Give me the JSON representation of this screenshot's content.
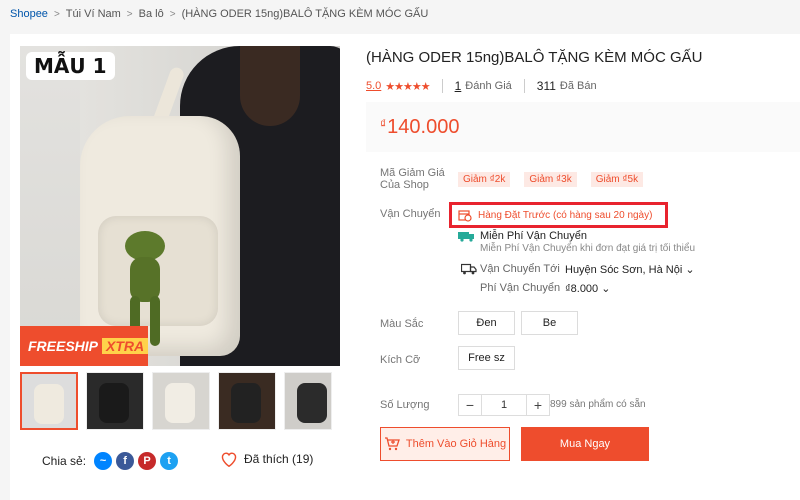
{
  "breadcrumb": {
    "items": [
      "Shopee",
      "Túi Ví Nam",
      "Ba lô",
      "(HÀNG ODER 15ng)BALÔ TẶNG KÈM MÓC GẤU"
    ]
  },
  "gallery": {
    "badge": "MẪU 1",
    "freeship": "FREESHIP",
    "xtra": "XTRA"
  },
  "share": {
    "label": "Chia sẻ:"
  },
  "like": {
    "label": "Đã thích (19)"
  },
  "product": {
    "title": "(HÀNG ODER 15ng)BALÔ TẶNG KÈM MÓC GẤU",
    "rating": "5.0",
    "stars": "★★★★★",
    "reviews_count": "1",
    "reviews_label": "Đánh Giá",
    "sold_count": "311",
    "sold_label": "Đã Bán",
    "currency": "₫",
    "price": "140.000"
  },
  "vouchers": {
    "label": "Mã Giảm Giá Của Shop",
    "items": [
      "Giảm ₫2k",
      "Giảm ₫3k",
      "Giảm ₫5k"
    ]
  },
  "shipping": {
    "label": "Vận Chuyển",
    "preorder": "Hàng Đặt Trước (có hàng sau 20 ngày)",
    "free_title": "Miễn Phí Vận Chuyển",
    "free_desc": "Miễn Phí Vận Chuyển khi đơn đạt giá trị tối thiểu",
    "ship_to_label": "Vận Chuyển Tới",
    "location": "Huyện Sóc Sơn, Hà Nội",
    "fee_label": "Phí Vận Chuyển",
    "fee": "₫8.000"
  },
  "color": {
    "label": "Màu Sắc",
    "options": [
      "Đen",
      "Be"
    ]
  },
  "size": {
    "label": "Kích Cỡ",
    "options": [
      "Free sz"
    ]
  },
  "quantity": {
    "label": "Số Lượng",
    "value": "1",
    "available": "899 sản phẩm có sẵn"
  },
  "actions": {
    "add_to_cart": "Thêm Vào Giỏ Hàng",
    "buy_now": "Mua Ngay"
  },
  "colors": {
    "accent": "#ee4d2d",
    "highlight": "#e8232e"
  }
}
